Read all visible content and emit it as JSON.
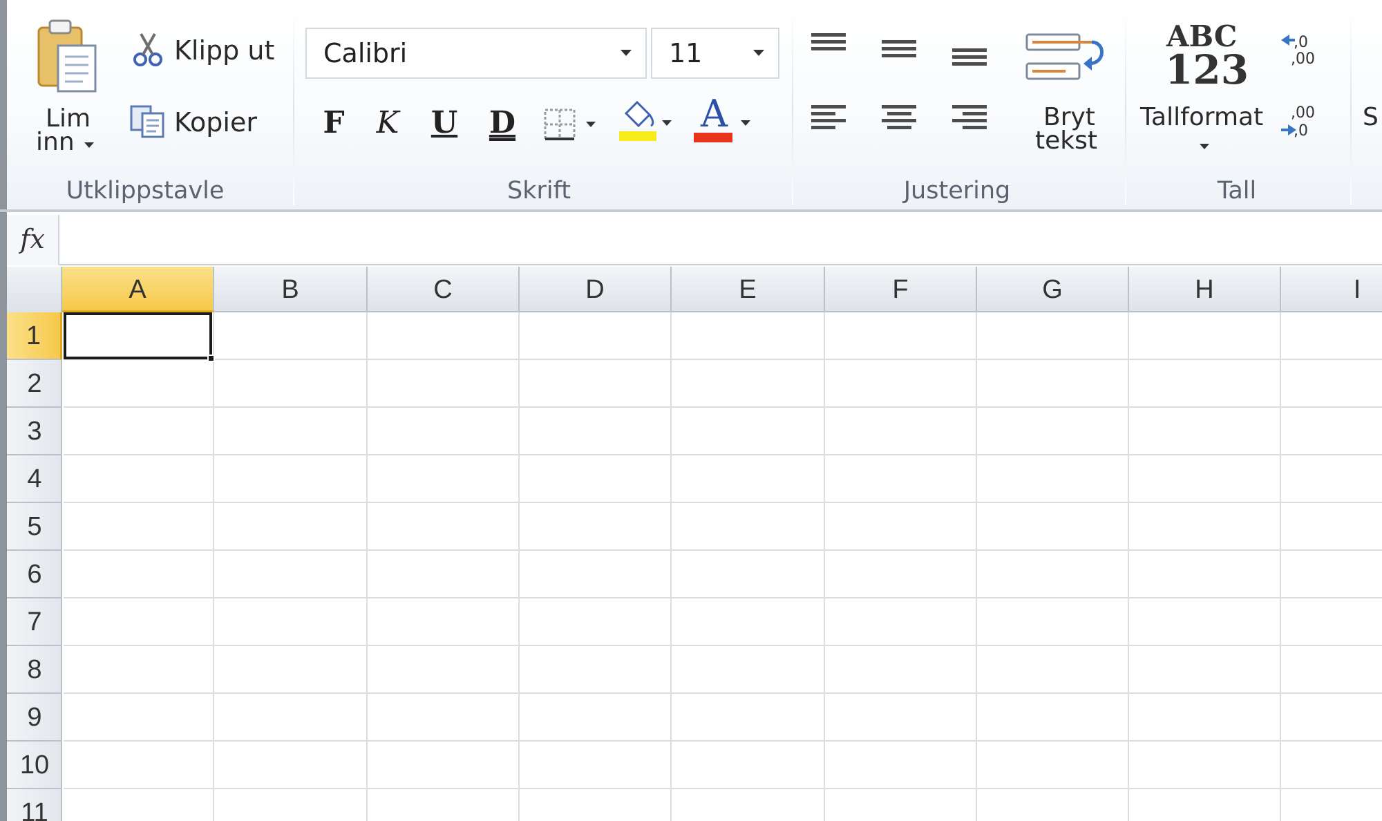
{
  "ribbon": {
    "clipboard": {
      "group_label": "Utklippstavle",
      "paste_label_line1": "Lim",
      "paste_label_line2": "inn",
      "cut_label": "Klipp ut",
      "copy_label": "Kopier"
    },
    "font": {
      "group_label": "Skrift",
      "font_name": "Calibri",
      "font_size": "11",
      "bold": "F",
      "italic": "K",
      "underline": "U",
      "double_underline": "D",
      "font_color_glyph": "A",
      "fill_color": "#f7ec1a",
      "font_color": "#e8341c"
    },
    "alignment": {
      "group_label": "Justering",
      "wrap_line1": "Bryt",
      "wrap_line2": "tekst"
    },
    "number": {
      "group_label": "Tall",
      "format_glyph_top": "ABC",
      "format_glyph_bottom": "123",
      "format_label": "Tallformat",
      "cut_off_label": "S"
    }
  },
  "formula_bar": {
    "fx_label": "fx",
    "value": ""
  },
  "sheet": {
    "columns": [
      "A",
      "B",
      "C",
      "D",
      "E",
      "F",
      "G",
      "H",
      "I"
    ],
    "rows": [
      "1",
      "2",
      "3",
      "4",
      "5",
      "6",
      "7",
      "8",
      "9",
      "10",
      "11"
    ],
    "selected_column": "A",
    "selected_row": "1",
    "selection_color": "#f6c94a"
  }
}
